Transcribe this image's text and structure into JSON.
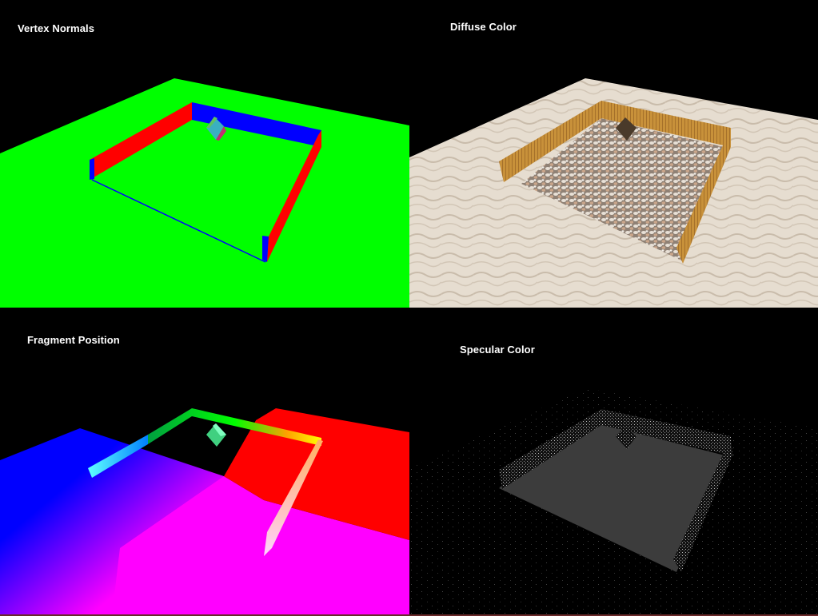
{
  "panels": {
    "vertex_normals": {
      "label": "Vertex Normals"
    },
    "diffuse_color": {
      "label": "Diffuse Color"
    },
    "fragment_position": {
      "label": "Fragment Position"
    },
    "specular_color": {
      "label": "Specular Color"
    }
  },
  "colors": {
    "background": "#000000",
    "normals_floor": "#00ff00",
    "normals_wall_x": "#ff0000",
    "normals_wall_z": "#0000ff",
    "sand": "#e6ddd0",
    "gravel": "#b7aa9c",
    "wood": "#c8913a",
    "position_blue": "#0000ff",
    "position_red": "#ff0000",
    "position_magenta": "#ff00ff",
    "specular_floor": "#3a3a3a"
  }
}
